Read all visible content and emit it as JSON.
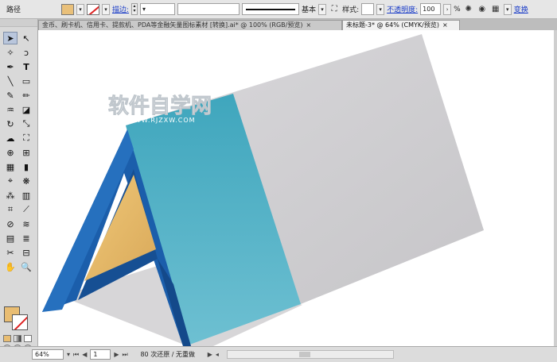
{
  "control_bar": {
    "object_type": "路径",
    "stroke_label": "描边:",
    "stroke_profile": "基本",
    "style_label": "样式:",
    "opacity_label": "不透明度:",
    "opacity_value": "100",
    "percent": "%",
    "transform_link": "变换",
    "fill_color": "#e9c07a",
    "icons": [
      "fill-swatch-icon",
      "stroke-swatch-icon",
      "recolor-icon",
      "align-icon",
      "isolate-icon"
    ]
  },
  "tabs": [
    {
      "label": "金币、刷卡机、信用卡、提款机、PDA等金融矢量图标素材 [转换].ai* @ 100% (RGB/预览)",
      "active": false,
      "close": "×"
    },
    {
      "label": "未标题-3* @ 64% (CMYK/预览)",
      "active": true,
      "close": "×"
    }
  ],
  "toolbox": {
    "tools": [
      "selection",
      "direct-selection",
      "magic-wand",
      "lasso",
      "pen",
      "type",
      "line",
      "rectangle",
      "paintbrush",
      "pencil",
      "blob-brush",
      "eraser",
      "rotate",
      "scale",
      "warp",
      "free-transform",
      "shape-builder",
      "perspective",
      "mesh",
      "gradient",
      "eyedropper",
      "blend",
      "symbol-sprayer",
      "graph",
      "artboard",
      "slice",
      "hand",
      "zoom"
    ],
    "fill_color": "#e9bd72"
  },
  "artwork": {
    "watermark_title": "软件自学网",
    "watermark_url": "WWW.RJZXW.COM",
    "colors": {
      "frame_blue": "#1b5eab",
      "inner_tri": "#e5b96a",
      "blue_band": "#4fb0c6",
      "grey_panel": "#cfced1",
      "shadow": "#d7d6d8"
    }
  },
  "status_bar": {
    "zoom": "64%",
    "artboard": "1",
    "status_text": "80 次还原 / 无重做"
  }
}
